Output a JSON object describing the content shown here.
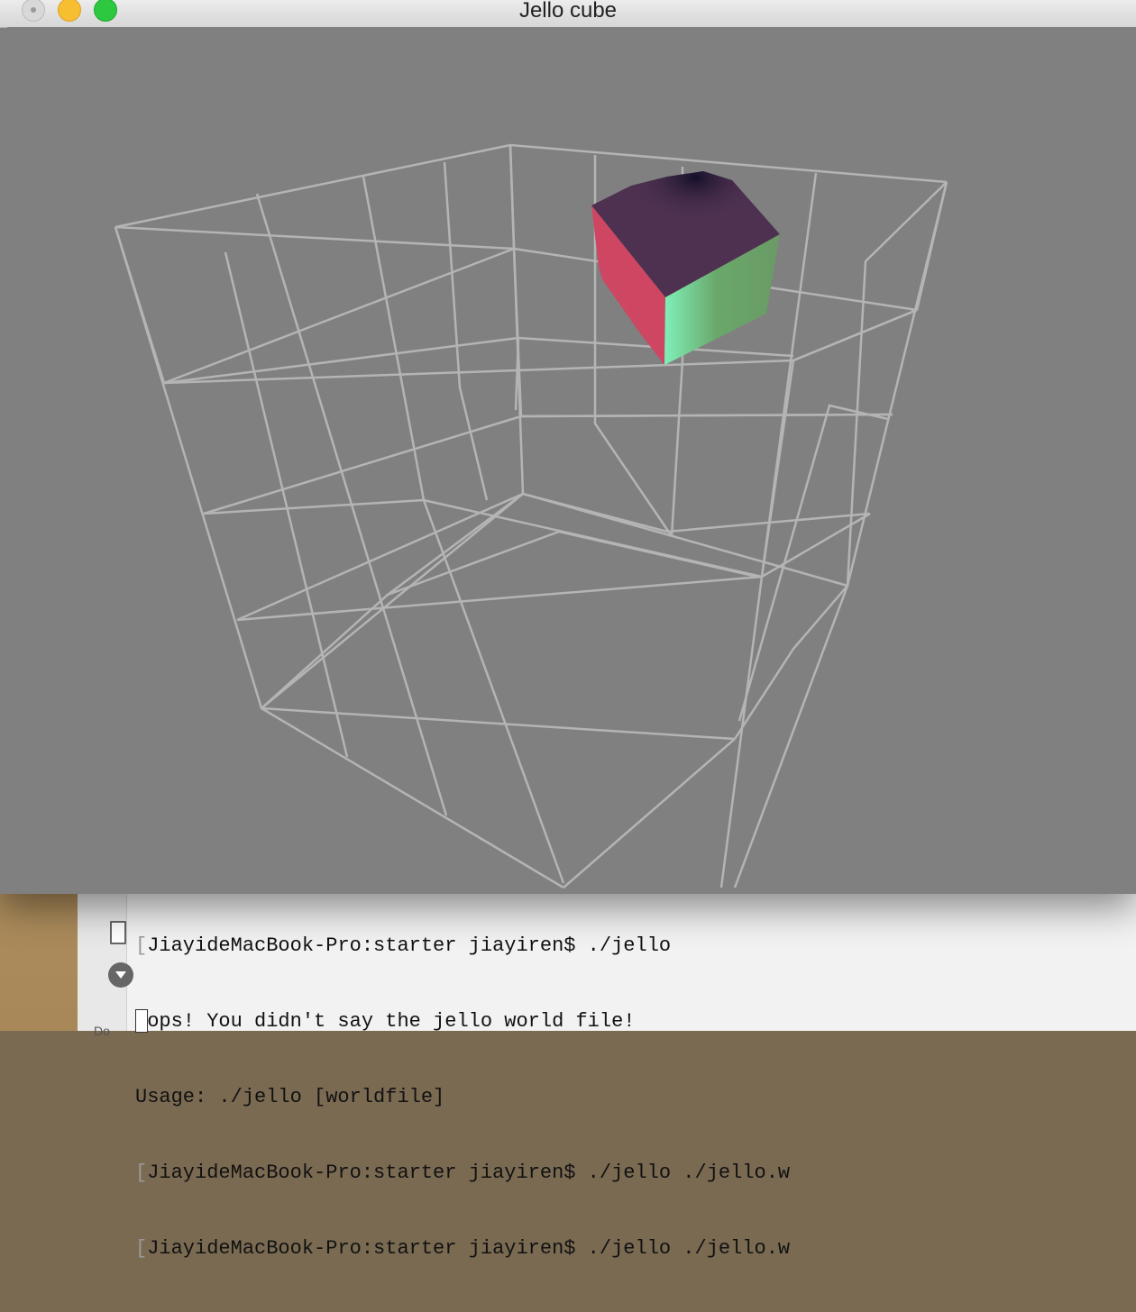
{
  "window": {
    "title": "Jello cube",
    "background_color": "#808080",
    "wireframe_color": "#b4b4b4"
  },
  "jello_cube": {
    "face_colors": {
      "top": "#4e3150",
      "left": "#cf4663",
      "right": "#6aa86a",
      "highlight": "#7ff0b8"
    }
  },
  "terminal": {
    "lines": [
      {
        "bracket": "[",
        "text": "JiayideMacBook-Pro:starter jiayiren$ ./jello"
      },
      {
        "bracket": "",
        "text": "Oops! You didn't say the jello world file!"
      },
      {
        "bracket": "",
        "text": "Usage: ./jello [worldfile]"
      },
      {
        "bracket": "[",
        "text": "JiayideMacBook-Pro:starter jiayiren$ ./jello ./jello.w"
      },
      {
        "bracket": "[",
        "text": "JiayideMacBook-Pro:starter jiayiren$ ./jello ./jello.w"
      }
    ],
    "sidebar_label": "Do"
  }
}
